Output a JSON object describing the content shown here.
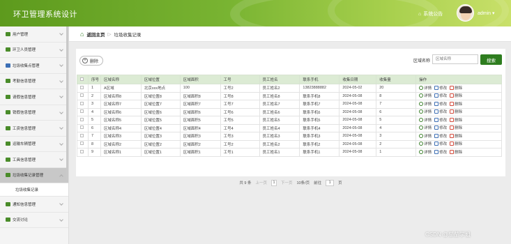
{
  "header": {
    "title": "环卫管理系统设计",
    "notice": "系统公告",
    "user": "admin"
  },
  "sidebar": {
    "items": [
      {
        "label": "用户管理",
        "color": "#4a8c2a"
      },
      {
        "label": "环卫人员管理",
        "color": "#4a8c2a"
      },
      {
        "label": "垃圾收集点管理",
        "color": "#3c6fb5"
      },
      {
        "label": "考勤信息管理",
        "color": "#4a8c2a"
      },
      {
        "label": "请假信息管理",
        "color": "#4a8c2a"
      },
      {
        "label": "销假信息管理",
        "color": "#4a8c2a"
      },
      {
        "label": "工资信息管理",
        "color": "#4a8c2a"
      },
      {
        "label": "运输车辆管理",
        "color": "#4a8c2a"
      },
      {
        "label": "工具信息管理",
        "color": "#4a8c2a"
      },
      {
        "label": "垃圾收集记录管理",
        "color": "#4a8c2a"
      }
    ],
    "sub_item": "垃圾收集记录",
    "items_after": [
      {
        "label": "通知信息管理",
        "color": "#4a8c2a"
      },
      {
        "label": "交流讨论",
        "color": "#4a8c2a"
      }
    ]
  },
  "breadcrumb": {
    "home": "返回主页",
    "current": "垃圾收集记录"
  },
  "toolbar": {
    "delete_label": "删除",
    "search_label": "区域名称",
    "search_placeholder": "区域名称",
    "search_button": "搜索"
  },
  "table": {
    "headers": [
      "",
      "序号",
      "区域名称",
      "区域位置",
      "区域面积",
      "工号",
      "员工姓名",
      "联系手机",
      "收集日期",
      "收集量",
      "操作"
    ],
    "rows": [
      [
        "1",
        "A区域",
        "北京xxx地点",
        "100",
        "工号2",
        "员工姓名2",
        "13823888882",
        "2024-05-02",
        "20"
      ],
      [
        "2",
        "区域名称8",
        "区域位置8",
        "区域面积8",
        "工号8",
        "员工姓名8",
        "联系手机8",
        "2024-05-08",
        "8"
      ],
      [
        "3",
        "区域名称7",
        "区域位置7",
        "区域面积7",
        "工号7",
        "员工姓名7",
        "联系手机7",
        "2024-05-08",
        "7"
      ],
      [
        "4",
        "区域名称6",
        "区域位置6",
        "区域面积6",
        "工号6",
        "员工姓名6",
        "联系手机6",
        "2024-05-08",
        "6"
      ],
      [
        "5",
        "区域名称5",
        "区域位置5",
        "区域面积5",
        "工号5",
        "员工姓名5",
        "联系手机5",
        "2024-05-08",
        "5"
      ],
      [
        "6",
        "区域名称4",
        "区域位置4",
        "区域面积4",
        "工号4",
        "员工姓名4",
        "联系手机4",
        "2024-05-08",
        "4"
      ],
      [
        "7",
        "区域名称3",
        "区域位置3",
        "区域面积3",
        "工号3",
        "员工姓名3",
        "联系手机3",
        "2024-05-08",
        "3"
      ],
      [
        "8",
        "区域名称2",
        "区域位置2",
        "区域面积2",
        "工号2",
        "员工姓名2",
        "联系手机2",
        "2024-05-08",
        "2"
      ],
      [
        "9",
        "区域名称1",
        "区域位置1",
        "区域面积1",
        "工号1",
        "员工姓名1",
        "联系手机1",
        "2024-05-08",
        "1"
      ]
    ],
    "actions": [
      "详情",
      "修改",
      "删除"
    ]
  },
  "pager": {
    "total": "共 9 条",
    "prev": "上一页",
    "page": "1",
    "next": "下一页",
    "size": "10条/页",
    "goto": "前往",
    "goto_value": "1",
    "page_unit": "页"
  },
  "watermark": "CSDN @茄茄学姐"
}
